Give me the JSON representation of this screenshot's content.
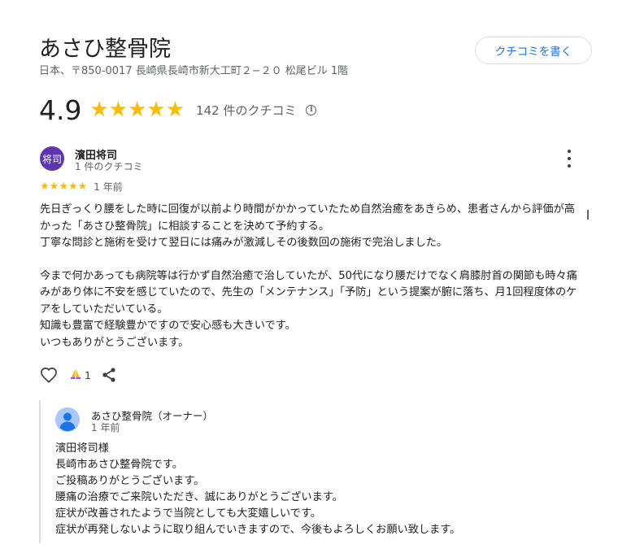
{
  "place": {
    "title": "あさひ整骨院",
    "address": "日本、〒850-0017 長崎県長崎市新大工町２−２０ 松尾ビル 1階",
    "write_review_label": "クチコミを書く"
  },
  "summary": {
    "rating": "4.9",
    "stars": 5,
    "review_count_label": "142 件のクチコミ",
    "info_glyph": "i"
  },
  "review": {
    "avatar_text": "将司",
    "avatar_color": "#5e35b1",
    "reviewer_name": "濱田将司",
    "reviewer_meta": "1 件のクチコミ",
    "stars": 5,
    "date": "1 年前",
    "paragraphs": [
      "先日ぎっくり腰をした時に回復が以前より時間がかかっていたため自然治癒をあきらめ、患者さんから評価が高かった「あさひ整骨院」に相談することを決めて予約する。",
      "丁寧な問診と施術を受けて翌日には痛みが激減しその後数回の施術で完治しました。",
      "",
      "今まで何かあっても病院等は行かず自然治癒で治していたが、50代になり腰だけでなく肩膝肘首の関節も時々痛みがあり体に不安を感じていたので、先生の「メンテナンス」「予防」という提案が腑に落ち、月1回程度体のケアをしていただいている。",
      "知識も豊富で経験豊かですので安心感も大きいです。",
      "いつもありがとうございます。"
    ],
    "helpful_count": "1"
  },
  "owner_response": {
    "name": "あさひ整骨院（オーナー）",
    "date": "1 年前",
    "lines": [
      "濱田将司様",
      "長崎市あさひ整骨院です。",
      "ご投稿ありがとうございます。",
      "腰痛の治療でご来院いただき、誠にありがとうございます。",
      "症状が改善されたようで当院としても大変嬉しいです。",
      "症状が再発しないように取り組んでいきますので、今後もよろしくお願い致します。"
    ]
  },
  "icons": {
    "star": "star-icon",
    "info": "info-icon",
    "menu": "more-vert-icon",
    "like": "heart-outline-icon",
    "helpful": "praise-hands-icon",
    "share": "share-icon",
    "owner_avatar": "person-icon"
  },
  "colors": {
    "accent": "#1a73e8",
    "star": "#fbbc04",
    "text_secondary": "#5f6368",
    "divider": "#dadce0"
  }
}
